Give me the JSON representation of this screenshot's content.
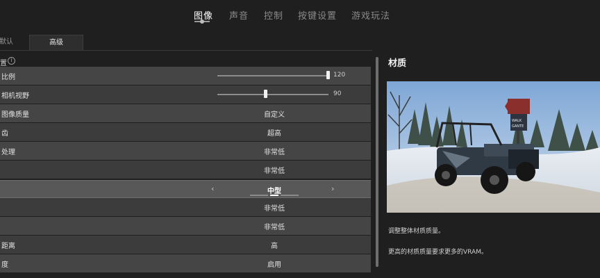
{
  "top_tabs": [
    {
      "label": "图像",
      "active": true
    },
    {
      "label": "声音",
      "active": false
    },
    {
      "label": "控制",
      "active": false
    },
    {
      "label": "按键设置",
      "active": false
    },
    {
      "label": "游戏玩法",
      "active": false
    }
  ],
  "subtabs": [
    {
      "label": "默认",
      "active": false
    },
    {
      "label": "高级",
      "active": true
    }
  ],
  "section_title": "置",
  "rows": [
    {
      "label": "比例",
      "type": "slider",
      "value": "120",
      "level": 1.0
    },
    {
      "label": "相机视野",
      "type": "slider",
      "value": "90",
      "level": 0.43
    },
    {
      "label": "图像质量",
      "type": "value",
      "value": "自定义"
    },
    {
      "label": "齿",
      "type": "value",
      "value": "超高"
    },
    {
      "label": "处理",
      "type": "value",
      "value": "非常低"
    },
    {
      "label": "",
      "type": "value",
      "value": "非常低"
    },
    {
      "label": "",
      "type": "select",
      "value": "中型",
      "selected": true
    },
    {
      "label": "",
      "type": "value",
      "value": "非常低"
    },
    {
      "label": "",
      "type": "value",
      "value": "非常低"
    },
    {
      "label": "距离",
      "type": "value",
      "value": "高"
    },
    {
      "label": "度",
      "type": "value",
      "value": "启用"
    }
  ],
  "detail": {
    "title": "材质",
    "description_1": "调整整体材质质量。",
    "description_2": "更高的材质质量要求更多的VRAM。",
    "sign_text": "WALK\nGANTE"
  },
  "colors": {
    "accent": "#ffffff",
    "row_bg": "#454545",
    "row_alt_bg": "#3c3c3c",
    "selected_bg": "#585858"
  }
}
